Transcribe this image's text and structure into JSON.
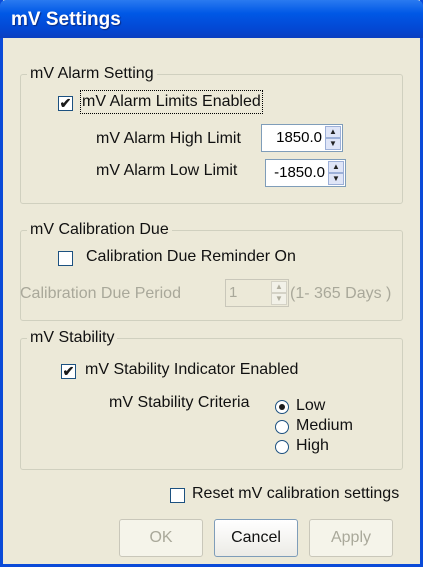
{
  "window": {
    "title": "mV Settings"
  },
  "alarm": {
    "legend": "mV Alarm Setting",
    "enabled_label": "mV Alarm Limits Enabled",
    "enabled_checked": true,
    "high_label": "mV Alarm High Limit",
    "high_value": "1850.0",
    "low_label": "mV Alarm Low Limit",
    "low_value": "-1850.0"
  },
  "calibration": {
    "legend": "mV Calibration Due",
    "reminder_label": "Calibration Due Reminder On",
    "reminder_checked": false,
    "period_label": "Calibration Due Period",
    "period_value": "1",
    "period_range": "(1- 365 Days )"
  },
  "stability": {
    "legend": "mV Stability",
    "enabled_label": "mV Stability Indicator Enabled",
    "enabled_checked": true,
    "criteria_label": "mV Stability Criteria",
    "options": [
      "Low",
      "Medium",
      "High"
    ],
    "selected": "Low"
  },
  "reset": {
    "label": "Reset mV calibration settings",
    "checked": false
  },
  "buttons": {
    "ok": "OK",
    "cancel": "Cancel",
    "apply": "Apply"
  }
}
